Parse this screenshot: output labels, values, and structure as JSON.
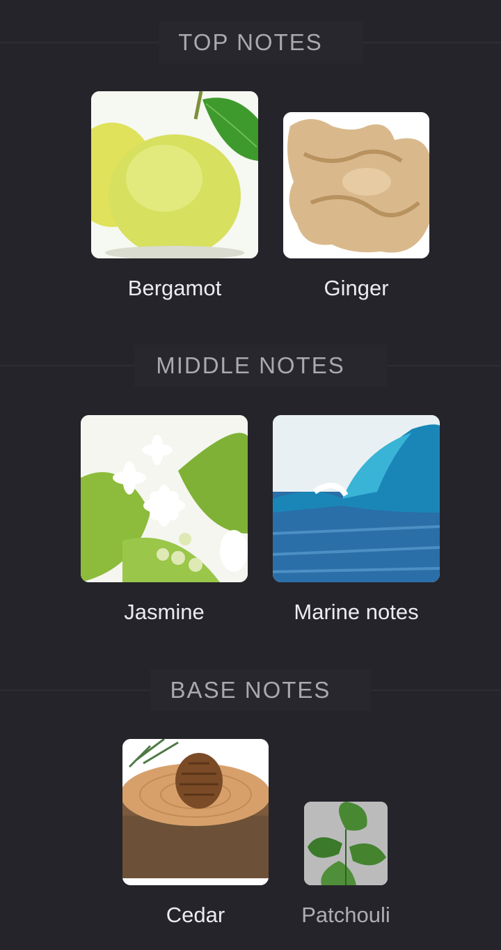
{
  "sections": {
    "top": {
      "title": "TOP NOTES",
      "notes": [
        {
          "label": "Bergamot",
          "icon": "bergamot-image"
        },
        {
          "label": "Ginger",
          "icon": "ginger-image"
        }
      ]
    },
    "middle": {
      "title": "MIDDLE NOTES",
      "notes": [
        {
          "label": "Jasmine",
          "icon": "jasmine-image"
        },
        {
          "label": "Marine notes",
          "icon": "wave-image"
        }
      ]
    },
    "base": {
      "title": "BASE NOTES",
      "notes": [
        {
          "label": "Cedar",
          "icon": "cedar-image"
        },
        {
          "label": "Patchouli",
          "icon": "patchouli-image"
        }
      ]
    }
  },
  "colors": {
    "background": "#25242a",
    "header_text": "#a9a9ae",
    "label_text": "#ececf0"
  }
}
